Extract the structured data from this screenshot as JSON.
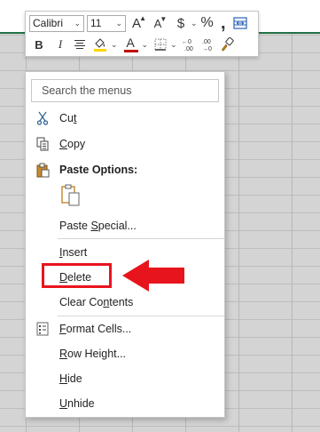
{
  "toolbar": {
    "font_name": "Calibri",
    "font_size": "11",
    "bold_label": "B",
    "italic_label": "I",
    "currency_symbol": "$",
    "percent_symbol": "%",
    "comma_symbol": ",",
    "increase_font_label": "A",
    "decrease_font_label": "A",
    "font_color_label": "A",
    "dd_glyph": "⌄",
    "colors": {
      "font_color_bar": "#c00000",
      "fill_color_bar": "#ffd400"
    },
    "icons": [
      "increase-font-size-icon",
      "decrease-font-size-icon",
      "accounting-format-icon",
      "percent-style-icon",
      "comma-style-icon",
      "format-table-icon",
      "center-align-icon",
      "fill-color-icon",
      "font-color-icon",
      "borders-icon",
      "increase-decimal-icon",
      "decrease-decimal-icon",
      "format-painter-icon"
    ]
  },
  "menu": {
    "search_placeholder": "Search the menus",
    "items": {
      "cut": {
        "pre": "Cu",
        "key": "t",
        "post": "",
        "icon": "scissors-icon"
      },
      "copy": {
        "pre": "",
        "key": "C",
        "post": "opy",
        "icon": "copy-icon"
      },
      "paste_options": {
        "label": "Paste Options:",
        "icon": "clipboard-icon"
      },
      "paste_special": {
        "pre": "Paste ",
        "key": "S",
        "post": "pecial...",
        "icon": ""
      },
      "insert": {
        "pre": "",
        "key": "I",
        "post": "nsert"
      },
      "delete": {
        "pre": "",
        "key": "D",
        "post": "elete"
      },
      "clear_contents": {
        "pre": "Clear Co",
        "key": "n",
        "post": "tents"
      },
      "format_cells": {
        "pre": "",
        "key": "F",
        "post": "ormat Cells...",
        "icon": "format-cells-icon"
      },
      "row_height": {
        "pre": "",
        "key": "R",
        "post": "ow Height..."
      },
      "hide": {
        "pre": "",
        "key": "H",
        "post": "ide"
      },
      "unhide": {
        "pre": "",
        "key": "U",
        "post": "nhide"
      }
    }
  },
  "annotation": {
    "highlight_color": "#e8141d",
    "arrow_color": "#e8141d"
  },
  "theme": {
    "excel_green": "#217346",
    "grid_bg": "#d4d4d4"
  }
}
